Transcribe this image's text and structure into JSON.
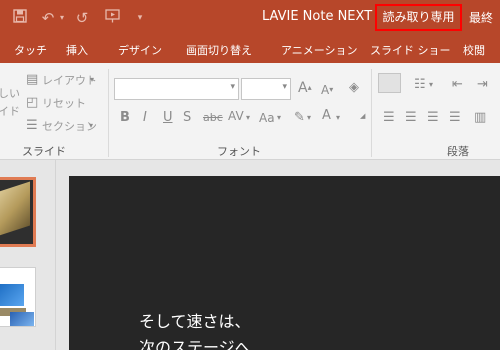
{
  "title_bar": {
    "document_name": "LAVIE Note NEXT",
    "readonly_label": "読み取り専用",
    "tail_label": "最終"
  },
  "ribbon_tabs": [
    {
      "label": "タッチ"
    },
    {
      "label": "挿入"
    },
    {
      "label": "デザイン"
    },
    {
      "label": "画面切り替え"
    },
    {
      "label": "アニメーション"
    },
    {
      "label": "スライド ショー"
    },
    {
      "label": "校閲"
    }
  ],
  "slides_group": {
    "cut_text_1": "しい",
    "cut_text_2": "イド",
    "layout_label": "レイアウト",
    "reset_label": "リセット",
    "section_label": "セクション",
    "group_label": "スライド"
  },
  "font_group": {
    "font_name": "",
    "font_size": "",
    "bold": "B",
    "italic": "I",
    "underline": "U",
    "shadow": "S",
    "strike": "abc",
    "spacing": "AV",
    "case": "Aa",
    "group_label": "フォント"
  },
  "paragraph_group": {
    "group_label": "段落"
  },
  "slide_content": {
    "line1": "そして速さは、",
    "line2": "次のステージへ"
  },
  "colors": {
    "brand": "#b7472a",
    "highlight": "#ff0000",
    "slide_bg": "#262626"
  },
  "icons": [
    "save-icon",
    "undo-icon",
    "redo-icon",
    "present-icon",
    "customize-qat-icon"
  ]
}
